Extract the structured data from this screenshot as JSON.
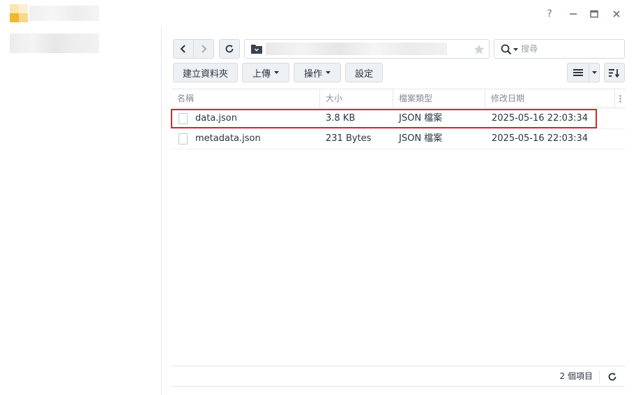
{
  "window": {
    "title": "",
    "controls": {
      "help": "?",
      "minimize": "—",
      "maximize": "□",
      "close": "✕"
    }
  },
  "toolbar": {
    "back_icon": "chevron-left-icon",
    "forward_icon": "chevron-right-icon",
    "refresh_icon": "refresh-icon",
    "path": "",
    "search_placeholder": "搜尋",
    "buttons": {
      "new_folder": "建立資料夾",
      "upload": "上傳",
      "action": "操作",
      "settings": "設定"
    }
  },
  "table": {
    "headers": {
      "name": "名稱",
      "size": "大小",
      "type": "檔案類型",
      "modified": "修改日期"
    },
    "rows": [
      {
        "name": "data.json",
        "size": "3.8 KB",
        "type": "JSON 檔案",
        "modified": "2025-05-16 22:03:34",
        "selected": true
      },
      {
        "name": "metadata.json",
        "size": "231 Bytes",
        "type": "JSON 檔案",
        "modified": "2025-05-16 22:03:34",
        "selected": false
      }
    ]
  },
  "footer": {
    "count": "2 個項目"
  },
  "colors": {
    "accent": "#d7252e",
    "logo_light": "#f7d98a",
    "logo_dark": "#f2b632"
  }
}
